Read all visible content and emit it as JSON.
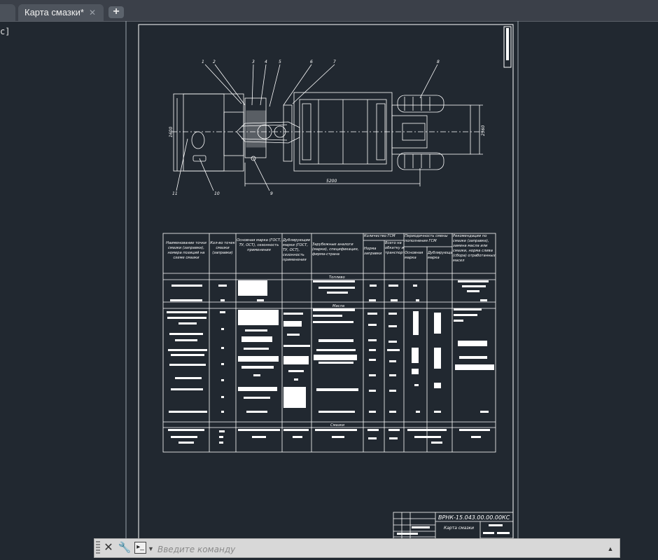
{
  "tabs": {
    "active_label": "Карта смазки*",
    "close_glyph": "✕",
    "add_glyph": "+"
  },
  "left_label": "с]",
  "drawing": {
    "callouts": [
      "1",
      "2",
      "3",
      "4",
      "5",
      "6",
      "7",
      "8"
    ],
    "callout_low": [
      "11",
      "10",
      "9"
    ],
    "dims": {
      "h_left": "1600",
      "h_right": "2560",
      "bottom": "5200"
    },
    "table_headers": [
      "Наименование точки смазки (заправки), номера позиций на схеме смазки",
      "Кол-во точек смазки (заправки)",
      "Основная марка (ГОСТ, ТУ, ОСТ), сезонность применения",
      "Дублирующие марки (ГОСТ, ТУ, ОСТ), сезонность применения",
      "Зарубежные аналоги (марки), спецификация, фирма-страна",
      "Количество ГСМ",
      "Норма заправки",
      "Всего на обкатку и транспортировку",
      "Периодичность смены пополнения ГСМ",
      "Основная марка",
      "Дублирующая марка",
      "Рекомендации по смазке (заправке), замена масла или смазки, норма слива (сбора) отработанных масел"
    ],
    "sections": [
      "Топливо",
      "Масла",
      "Смазки"
    ],
    "title_block": {
      "code": "ВРНК-15.043.00.00.00КС",
      "name": "Карта смазки"
    }
  },
  "command": {
    "placeholder": "Введите команду",
    "close_icon": "close-icon",
    "settings_icon": "wrench-icon"
  },
  "colors": {
    "background": "#212830",
    "lines": "#ffffff",
    "tabbar": "#3b4049"
  }
}
